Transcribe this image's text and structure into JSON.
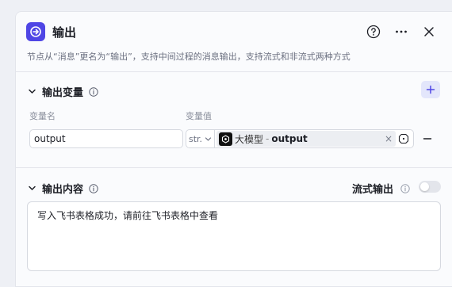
{
  "header": {
    "title": "输出",
    "description": "节点从“消息”更名为“输出”，支持中间过程的消息输出，支持流式和非流式两种方式",
    "icon": "output-node-icon",
    "accent": "#4f46e5"
  },
  "output_vars": {
    "title": "输出变量",
    "col_name": "变量名",
    "col_value": "变量值",
    "rows": [
      {
        "name": "output",
        "type": "str.",
        "source": "大模型",
        "separator": "-",
        "variable": "output"
      }
    ]
  },
  "output_content": {
    "title": "输出内容",
    "stream_label": "流式输出",
    "stream_enabled": false,
    "text": "写入飞书表格成功，请前往飞书表格中查看"
  }
}
